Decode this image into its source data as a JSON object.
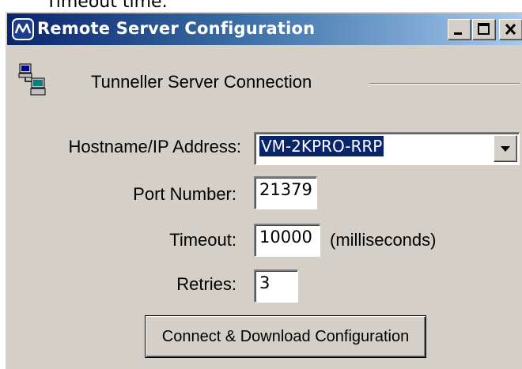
{
  "partial_text_top": "Timeout time.",
  "window": {
    "title": "Remote Server Configuration",
    "icon": "remote-config-logo-icon",
    "controls": [
      "minimize-icon",
      "maximize-icon",
      "close-icon"
    ]
  },
  "group": {
    "title": "Tunneller Server Connection",
    "icon": "network-computers-icon"
  },
  "fields": {
    "hostname_label": "Hostname/IP Address:",
    "hostname_value": "VM-2KPRO-RRP",
    "port_label": "Port Number:",
    "port_value": "21379",
    "timeout_label": "Timeout:",
    "timeout_value": "10000",
    "timeout_units": "(milliseconds)",
    "retries_label": "Retries:",
    "retries_value": "3"
  },
  "buttons": {
    "connect_label": "Connect & Download Configuration"
  },
  "colors": {
    "titlebar_start": "#0a246a",
    "titlebar_end": "#a6caf0",
    "face": "#d4d0c8",
    "selection": "#0a246a"
  }
}
